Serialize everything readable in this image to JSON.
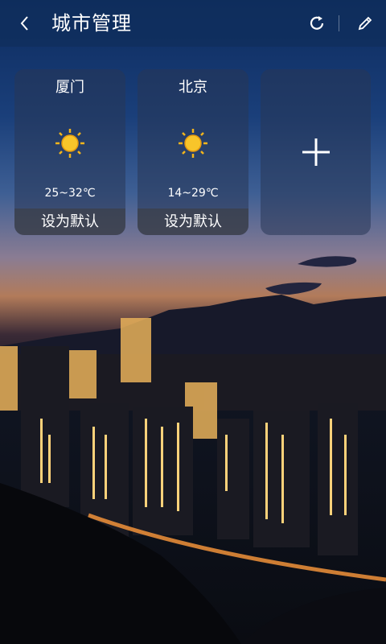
{
  "header": {
    "title": "城市管理",
    "back_icon": "chevron-left-icon",
    "refresh_icon": "refresh-icon",
    "edit_icon": "pencil-icon"
  },
  "cities": [
    {
      "name": "厦门",
      "temp": "25~32℃",
      "weather_icon": "sunny-icon",
      "default_label": "设为默认"
    },
    {
      "name": "北京",
      "temp": "14~29℃",
      "weather_icon": "sunny-icon",
      "default_label": "设为默认"
    }
  ],
  "add_city": {
    "icon": "plus-icon"
  },
  "colors": {
    "header_bg": "#102e5c",
    "sun": "#f3b51c"
  }
}
